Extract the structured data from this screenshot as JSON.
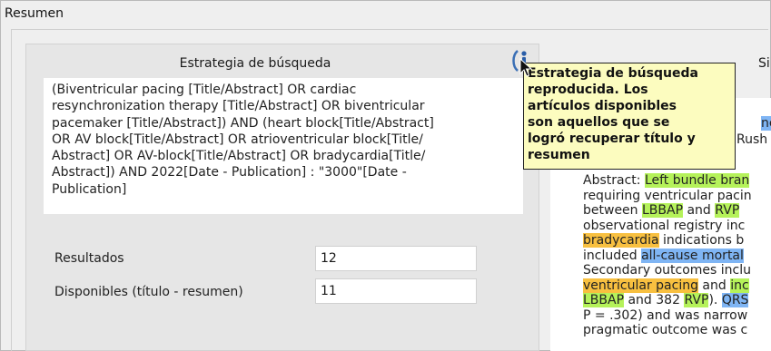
{
  "window": {
    "title": "Resumen"
  },
  "strategy": {
    "heading": "Estrategia de búsqueda",
    "query_lines": [
      "(Biventricular pacing [Title/Abstract] OR cardiac",
      "resynchronization therapy [Title/Abstract] OR biventricular",
      "pacemaker [Title/Abstract]) AND (heart block[Title/Abstract]",
      "OR AV block[Title/Abstract] OR atrioventricular block[Title/",
      "Abstract] OR AV-block[Title/Abstract] OR bradycardia[Title/",
      "Abstract]) AND 2022[Date - Publication] : \"3000\"[Date -",
      "Publication]"
    ]
  },
  "results": {
    "label": "Resultados",
    "value": "12"
  },
  "available": {
    "label": "Disponibles (título - resumen)",
    "value": "11"
  },
  "tooltip": {
    "lines": [
      "Estrategia de búsqueda",
      "reproducida. Los",
      "artículos disponibles",
      "son aquellos que se",
      "logró recuperar título y",
      "resumen"
    ]
  },
  "info_icon": "info-icon",
  "right_panel": {
    "heading_fragment": "Si",
    "peek_fragments": [
      "nes of",
      "Rush C"
    ],
    "abstract_lines": [
      [
        {
          "t": "Abstract: "
        },
        {
          "t": "Left bundle bran",
          "h": "g"
        }
      ],
      [
        {
          "t": "requiring ventricular pacin"
        }
      ],
      [
        {
          "t": "between "
        },
        {
          "t": "LBBAP",
          "h": "g"
        },
        {
          "t": " and "
        },
        {
          "t": "RVP",
          "h": "g"
        }
      ],
      [
        {
          "t": "observational registry inc"
        }
      ],
      [
        {
          "t": "bradycardia",
          "h": "o"
        },
        {
          "t": " indications b"
        }
      ],
      [
        {
          "t": "included "
        },
        {
          "t": "all-cause mortal",
          "h": "b"
        }
      ],
      [
        {
          "t": "Secondary outcomes inclu"
        }
      ],
      [
        {
          "t": "ventricular pacing",
          "h": "o"
        },
        {
          "t": " and "
        },
        {
          "t": "inc",
          "h": "g"
        }
      ],
      [
        {
          "t": "LBBAP",
          "h": "g"
        },
        {
          "t": " and 382 "
        },
        {
          "t": "RVP",
          "h": "g"
        },
        {
          "t": "). "
        },
        {
          "t": "QRS",
          "h": "b"
        }
      ],
      [
        {
          "t": "P = .302) and was narrow"
        }
      ],
      [
        {
          "t": "pragmatic outcome was c"
        }
      ]
    ]
  },
  "colors": {
    "highlight_green": "#b5f25a",
    "highlight_blue": "#7fb5f4",
    "highlight_orange": "#f8c040",
    "tooltip_bg": "#fcfcbf"
  }
}
